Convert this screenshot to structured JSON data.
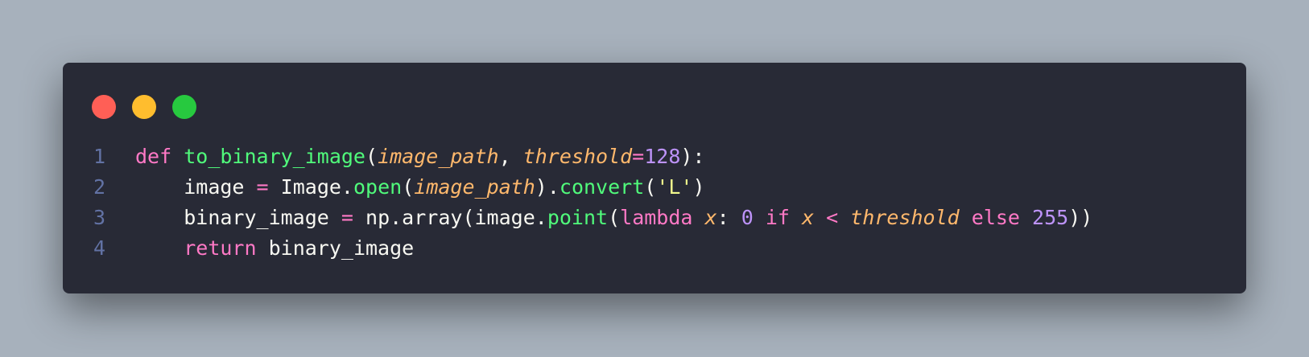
{
  "window": {
    "controls": {
      "close_color": "#ff5f56",
      "minimize_color": "#ffbd2e",
      "maximize_color": "#27c93f"
    }
  },
  "theme": {
    "background": "#282a36",
    "page_background": "#a7b1bc",
    "keyword": "#ff79c6",
    "function": "#50fa7b",
    "parameter": "#ffb86c",
    "number": "#bd93f9",
    "string": "#f1fa8c",
    "line_number": "#6272a4"
  },
  "code": {
    "lines": [
      {
        "number": "1",
        "t_def": "def",
        "t_space1": " ",
        "t_fn": "to_binary_image",
        "t_open": "(",
        "t_p1": "image_path",
        "t_comma": ", ",
        "t_p2": "threshold",
        "t_eq": "=",
        "t_num": "128",
        "t_close": "):"
      },
      {
        "number": "2",
        "t_indent": "    ",
        "t_var": "image",
        "t_sp1": " ",
        "t_eq": "=",
        "t_sp2": " ",
        "t_obj": "Image.",
        "t_fn1": "open",
        "t_open1": "(",
        "t_param": "image_path",
        "t_close1": ").",
        "t_fn2": "convert",
        "t_open2": "(",
        "t_str": "'L'",
        "t_close2": ")"
      },
      {
        "number": "3",
        "t_indent": "    ",
        "t_var": "binary_image",
        "t_sp1": " ",
        "t_eq": "=",
        "t_sp2": " ",
        "t_call": "np.array(image.",
        "t_fn": "point",
        "t_open": "(",
        "t_lambda": "lambda",
        "t_sp3": " ",
        "t_x1": "x",
        "t_colon": ": ",
        "t_zero": "0",
        "t_sp4": " ",
        "t_if": "if",
        "t_sp5": " ",
        "t_x2": "x",
        "t_sp6": " ",
        "t_lt": "<",
        "t_sp7": " ",
        "t_thr": "threshold",
        "t_sp8": " ",
        "t_else": "else",
        "t_sp9": " ",
        "t_255": "255",
        "t_close": "))"
      },
      {
        "number": "4",
        "t_indent": "    ",
        "t_return": "return",
        "t_sp": " ",
        "t_var": "binary_image"
      }
    ]
  }
}
